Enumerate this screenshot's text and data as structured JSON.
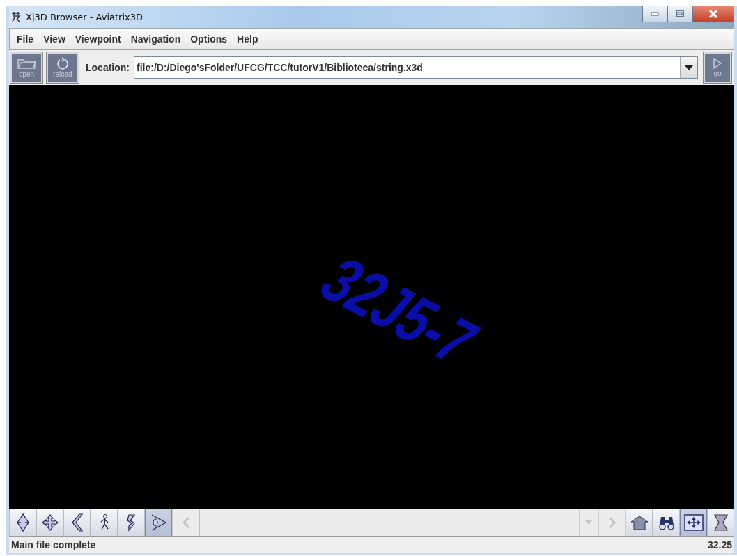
{
  "window": {
    "title": "Xj3D Browser - Aviatrix3D"
  },
  "menu": [
    "File",
    "View",
    "Viewpoint",
    "Navigation",
    "Options",
    "Help"
  ],
  "toolbar": {
    "buttons": [
      {
        "kind": "open",
        "label": "open"
      },
      {
        "kind": "reload",
        "label": "reload"
      }
    ],
    "location_label": "Location:",
    "location": "file:/D:/Diego'sFolder/UFCG/TCC/tutorV1/Biblioteca/string.x3d",
    "go_label": "go"
  },
  "viewport": {
    "scene_text": "32J5-7"
  },
  "nav_modes": [
    {
      "kind": "fly",
      "selected": false
    },
    {
      "kind": "pan",
      "selected": false
    },
    {
      "kind": "tilt",
      "selected": false
    },
    {
      "kind": "walk",
      "selected": false
    },
    {
      "kind": "spin",
      "selected": false
    },
    {
      "kind": "examine",
      "selected": true
    }
  ],
  "viewpoint_controls": [
    {
      "kind": "prev",
      "disabled": true
    },
    {
      "kind": "list",
      "disabled": true
    },
    {
      "kind": "next",
      "disabled": true
    }
  ],
  "right_tools": [
    {
      "kind": "home",
      "selected": false
    },
    {
      "kind": "fit",
      "selected": false
    },
    {
      "kind": "move",
      "selected": true
    },
    {
      "kind": "console",
      "selected": false
    }
  ],
  "status_bar": {
    "message": "Main file complete",
    "frame_rate": "32.25"
  }
}
